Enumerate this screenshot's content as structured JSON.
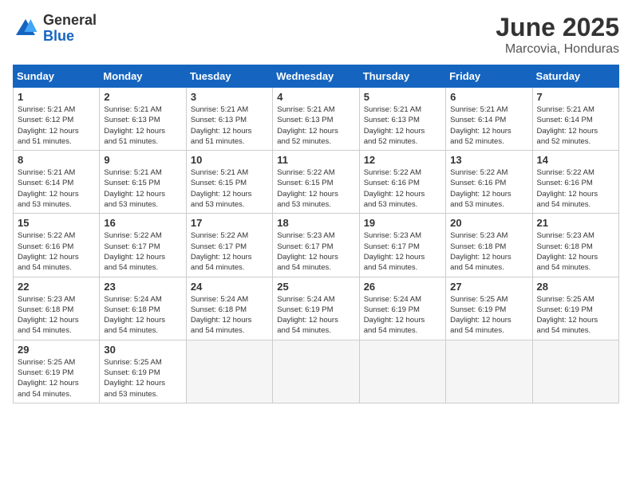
{
  "header": {
    "logo_general": "General",
    "logo_blue": "Blue",
    "title": "June 2025",
    "subtitle": "Marcovia, Honduras"
  },
  "calendar": {
    "days_of_week": [
      "Sunday",
      "Monday",
      "Tuesday",
      "Wednesday",
      "Thursday",
      "Friday",
      "Saturday"
    ],
    "weeks": [
      [
        {
          "day": "",
          "info": ""
        },
        {
          "day": "2",
          "info": "Sunrise: 5:21 AM\nSunset: 6:13 PM\nDaylight: 12 hours\nand 51 minutes."
        },
        {
          "day": "3",
          "info": "Sunrise: 5:21 AM\nSunset: 6:13 PM\nDaylight: 12 hours\nand 51 minutes."
        },
        {
          "day": "4",
          "info": "Sunrise: 5:21 AM\nSunset: 6:13 PM\nDaylight: 12 hours\nand 52 minutes."
        },
        {
          "day": "5",
          "info": "Sunrise: 5:21 AM\nSunset: 6:13 PM\nDaylight: 12 hours\nand 52 minutes."
        },
        {
          "day": "6",
          "info": "Sunrise: 5:21 AM\nSunset: 6:14 PM\nDaylight: 12 hours\nand 52 minutes."
        },
        {
          "day": "7",
          "info": "Sunrise: 5:21 AM\nSunset: 6:14 PM\nDaylight: 12 hours\nand 52 minutes."
        }
      ],
      [
        {
          "day": "1",
          "info": "Sunrise: 5:21 AM\nSunset: 6:12 PM\nDaylight: 12 hours\nand 51 minutes."
        },
        {
          "day": "",
          "info": ""
        },
        {
          "day": "",
          "info": ""
        },
        {
          "day": "",
          "info": ""
        },
        {
          "day": "",
          "info": ""
        },
        {
          "day": "",
          "info": ""
        },
        {
          "day": "",
          "info": ""
        }
      ],
      [
        {
          "day": "8",
          "info": "Sunrise: 5:21 AM\nSunset: 6:14 PM\nDaylight: 12 hours\nand 53 minutes."
        },
        {
          "day": "9",
          "info": "Sunrise: 5:21 AM\nSunset: 6:15 PM\nDaylight: 12 hours\nand 53 minutes."
        },
        {
          "day": "10",
          "info": "Sunrise: 5:21 AM\nSunset: 6:15 PM\nDaylight: 12 hours\nand 53 minutes."
        },
        {
          "day": "11",
          "info": "Sunrise: 5:22 AM\nSunset: 6:15 PM\nDaylight: 12 hours\nand 53 minutes."
        },
        {
          "day": "12",
          "info": "Sunrise: 5:22 AM\nSunset: 6:16 PM\nDaylight: 12 hours\nand 53 minutes."
        },
        {
          "day": "13",
          "info": "Sunrise: 5:22 AM\nSunset: 6:16 PM\nDaylight: 12 hours\nand 53 minutes."
        },
        {
          "day": "14",
          "info": "Sunrise: 5:22 AM\nSunset: 6:16 PM\nDaylight: 12 hours\nand 54 minutes."
        }
      ],
      [
        {
          "day": "15",
          "info": "Sunrise: 5:22 AM\nSunset: 6:16 PM\nDaylight: 12 hours\nand 54 minutes."
        },
        {
          "day": "16",
          "info": "Sunrise: 5:22 AM\nSunset: 6:17 PM\nDaylight: 12 hours\nand 54 minutes."
        },
        {
          "day": "17",
          "info": "Sunrise: 5:22 AM\nSunset: 6:17 PM\nDaylight: 12 hours\nand 54 minutes."
        },
        {
          "day": "18",
          "info": "Sunrise: 5:23 AM\nSunset: 6:17 PM\nDaylight: 12 hours\nand 54 minutes."
        },
        {
          "day": "19",
          "info": "Sunrise: 5:23 AM\nSunset: 6:17 PM\nDaylight: 12 hours\nand 54 minutes."
        },
        {
          "day": "20",
          "info": "Sunrise: 5:23 AM\nSunset: 6:18 PM\nDaylight: 12 hours\nand 54 minutes."
        },
        {
          "day": "21",
          "info": "Sunrise: 5:23 AM\nSunset: 6:18 PM\nDaylight: 12 hours\nand 54 minutes."
        }
      ],
      [
        {
          "day": "22",
          "info": "Sunrise: 5:23 AM\nSunset: 6:18 PM\nDaylight: 12 hours\nand 54 minutes."
        },
        {
          "day": "23",
          "info": "Sunrise: 5:24 AM\nSunset: 6:18 PM\nDaylight: 12 hours\nand 54 minutes."
        },
        {
          "day": "24",
          "info": "Sunrise: 5:24 AM\nSunset: 6:18 PM\nDaylight: 12 hours\nand 54 minutes."
        },
        {
          "day": "25",
          "info": "Sunrise: 5:24 AM\nSunset: 6:19 PM\nDaylight: 12 hours\nand 54 minutes."
        },
        {
          "day": "26",
          "info": "Sunrise: 5:24 AM\nSunset: 6:19 PM\nDaylight: 12 hours\nand 54 minutes."
        },
        {
          "day": "27",
          "info": "Sunrise: 5:25 AM\nSunset: 6:19 PM\nDaylight: 12 hours\nand 54 minutes."
        },
        {
          "day": "28",
          "info": "Sunrise: 5:25 AM\nSunset: 6:19 PM\nDaylight: 12 hours\nand 54 minutes."
        }
      ],
      [
        {
          "day": "29",
          "info": "Sunrise: 5:25 AM\nSunset: 6:19 PM\nDaylight: 12 hours\nand 54 minutes."
        },
        {
          "day": "30",
          "info": "Sunrise: 5:25 AM\nSunset: 6:19 PM\nDaylight: 12 hours\nand 53 minutes."
        },
        {
          "day": "",
          "info": ""
        },
        {
          "day": "",
          "info": ""
        },
        {
          "day": "",
          "info": ""
        },
        {
          "day": "",
          "info": ""
        },
        {
          "day": "",
          "info": ""
        }
      ]
    ]
  }
}
